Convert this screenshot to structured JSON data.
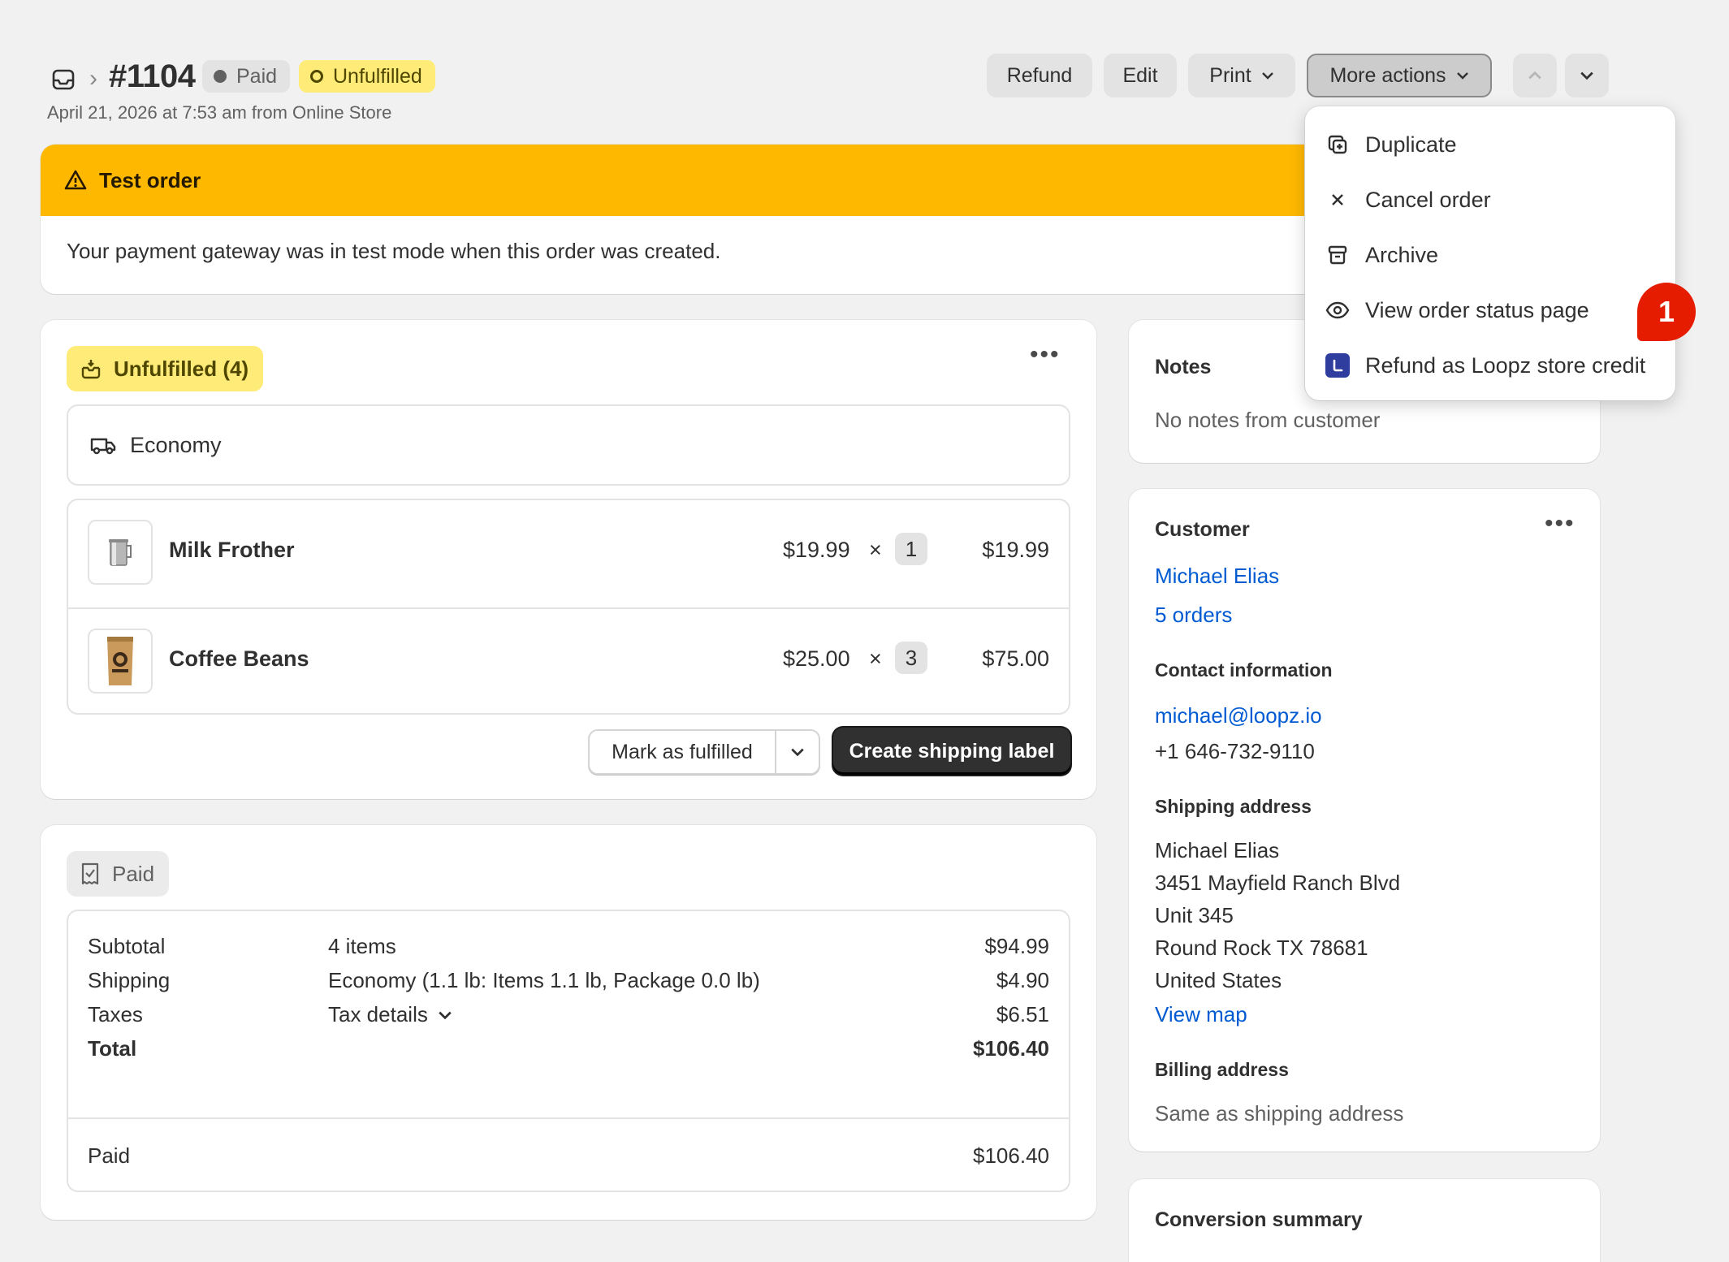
{
  "header": {
    "order_number": "#1104",
    "payment_badge": "Paid",
    "fulfillment_badge": "Unfulfilled",
    "subtitle": "April 21, 2026 at 7:53 am from Online Store",
    "buttons": {
      "refund": "Refund",
      "edit": "Edit",
      "print": "Print",
      "more_actions": "More actions"
    }
  },
  "banner": {
    "title": "Test order",
    "message": "Your payment gateway was in test mode when this order was created."
  },
  "fulfillment": {
    "badge": "Unfulfilled (4)",
    "shipping_method": "Economy",
    "items": [
      {
        "name": "Milk Frother",
        "price": "$19.99",
        "times": "×",
        "qty": "1",
        "total": "$19.99"
      },
      {
        "name": "Coffee Beans",
        "price": "$25.00",
        "times": "×",
        "qty": "3",
        "total": "$75.00"
      }
    ],
    "mark_fulfilled": "Mark as fulfilled",
    "create_label": "Create shipping label"
  },
  "payment": {
    "badge": "Paid",
    "rows": [
      {
        "label": "Subtotal",
        "detail": "4 items",
        "amount": "$94.99"
      },
      {
        "label": "Shipping",
        "detail": "Economy (1.1 lb: Items 1.1 lb, Package 0.0 lb)",
        "amount": "$4.90"
      },
      {
        "label": "Taxes",
        "detail": "Tax details",
        "amount": "$6.51"
      },
      {
        "label": "Total",
        "detail": "",
        "amount": "$106.40"
      }
    ],
    "paid_label": "Paid",
    "paid_amount": "$106.40"
  },
  "notes": {
    "title": "Notes",
    "text": "No notes from customer"
  },
  "customer": {
    "title": "Customer",
    "name": "Michael Elias",
    "orders": "5 orders",
    "contact_title": "Contact information",
    "email": "michael@loopz.io",
    "phone": "+1 646-732-9110",
    "shipping_title": "Shipping address",
    "address_lines": [
      "Michael Elias",
      "3451 Mayfield Ranch Blvd",
      "Unit 345",
      "Round Rock TX 78681",
      "United States"
    ],
    "view_map": "View map",
    "billing_title": "Billing address",
    "billing_text": "Same as shipping address"
  },
  "conversion": {
    "title": "Conversion summary"
  },
  "more_menu": {
    "items": [
      "Duplicate",
      "Cancel order",
      "Archive",
      "View order status page",
      "Refund as Loopz store credit"
    ]
  },
  "notification_count": "1",
  "colors": {
    "banner": "#ffb800",
    "unfulfilled_badge": "#ffeb78",
    "link": "#005bd3",
    "primary_button": "#303030",
    "notification": "#e51c00"
  }
}
